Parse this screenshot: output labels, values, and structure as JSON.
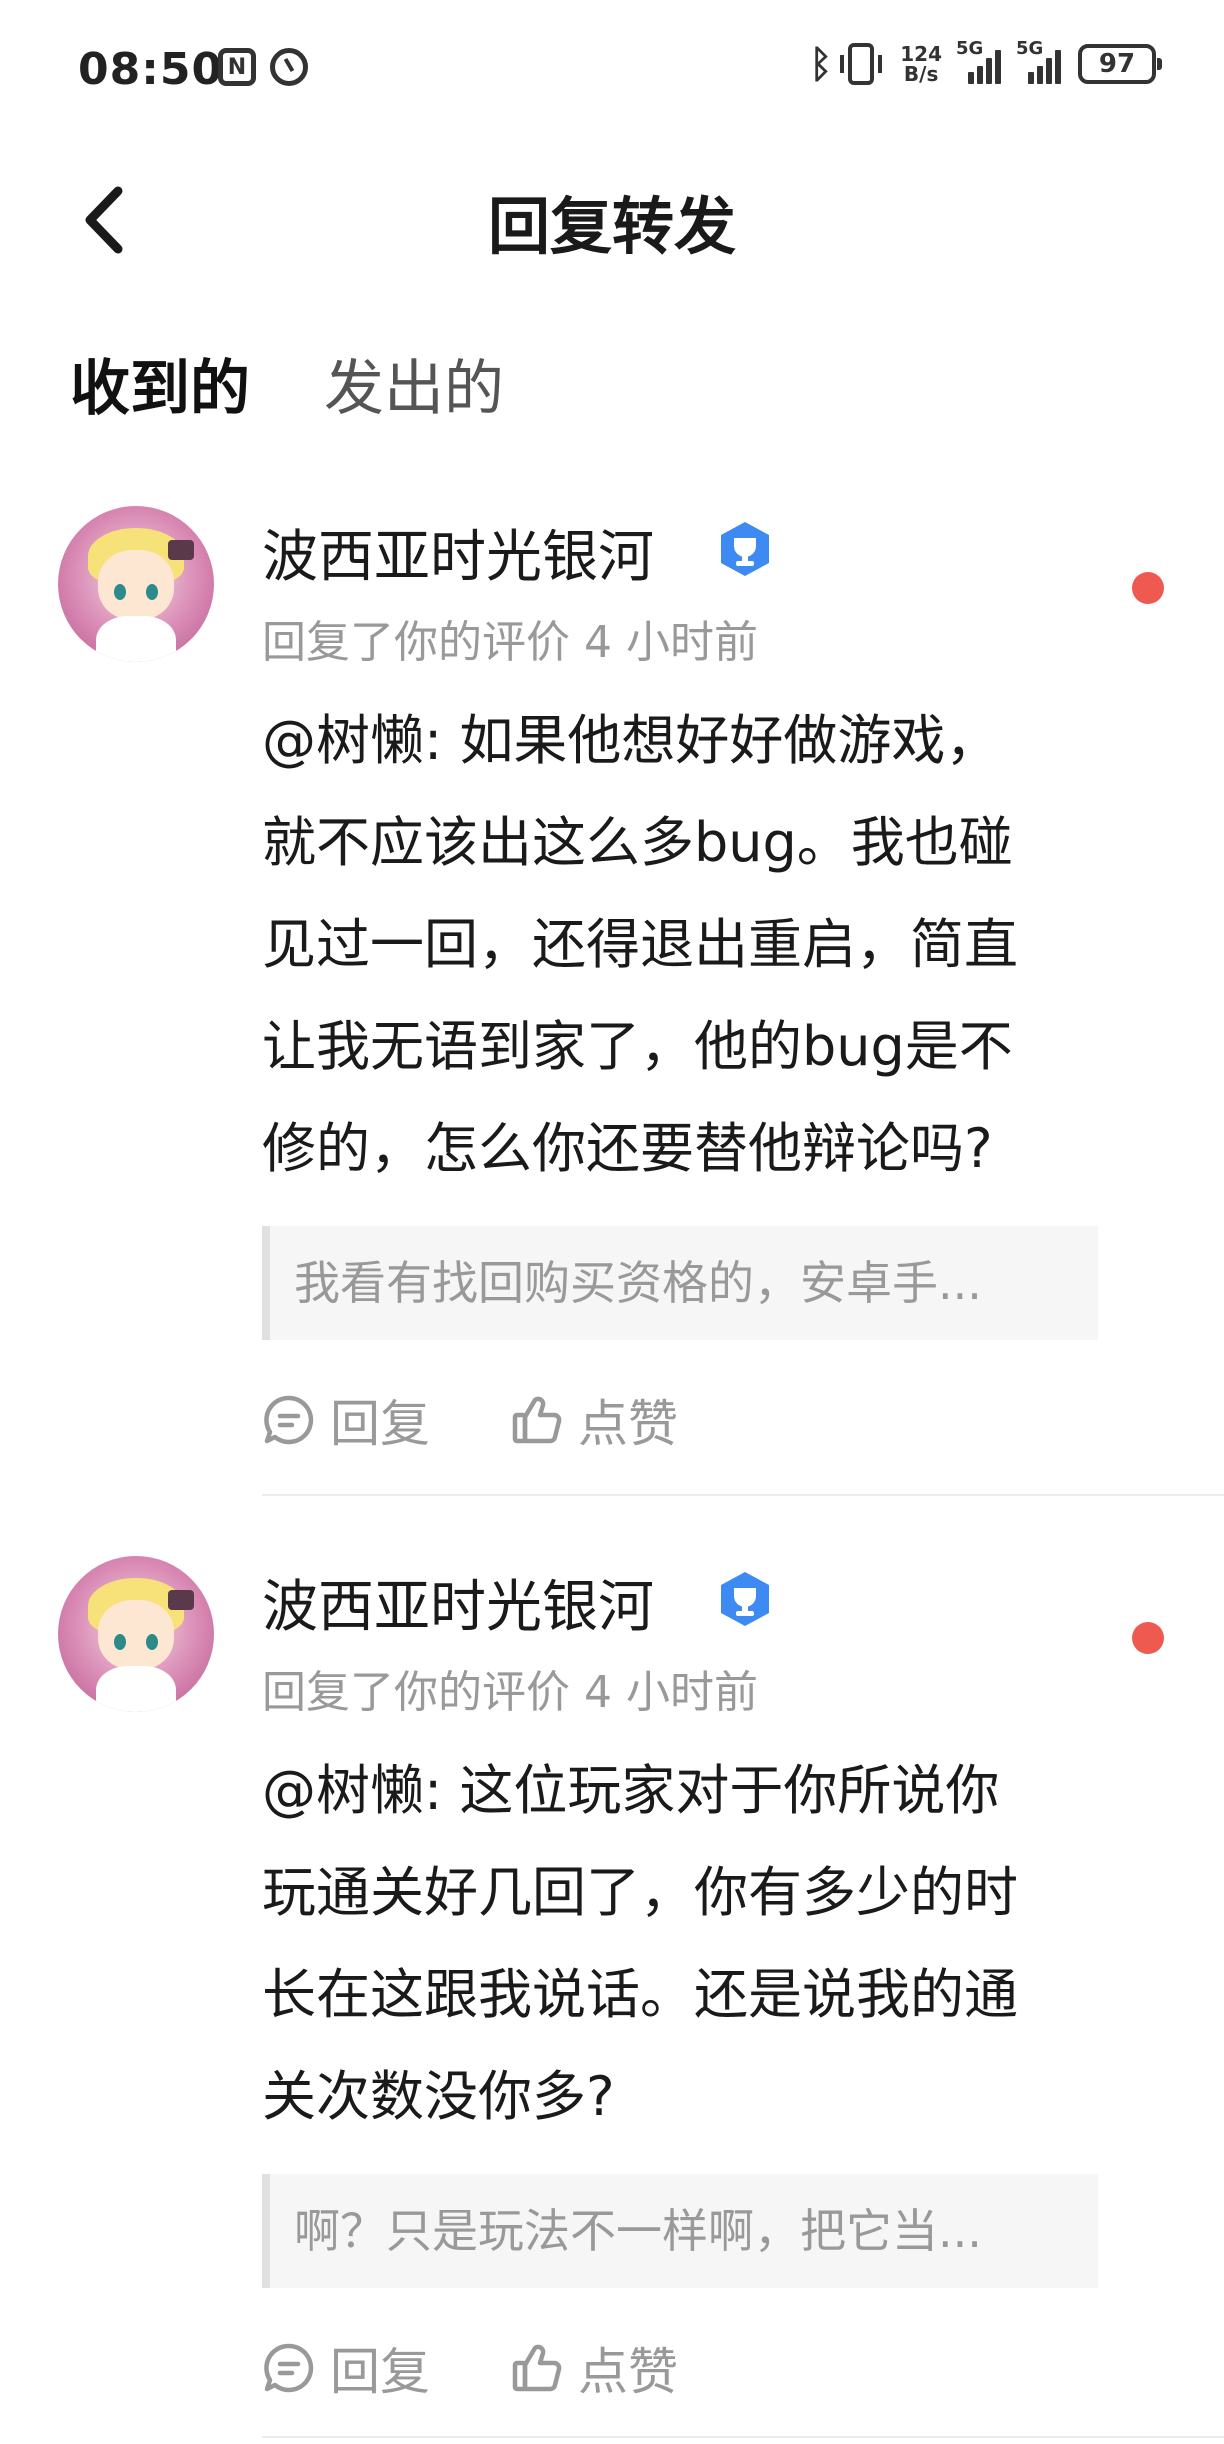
{
  "status_bar": {
    "time": "08:50",
    "nfc_label": "N",
    "speed_top": "124",
    "speed_bottom": "B/s",
    "sim1_label": "5G",
    "sim2_label": "5G",
    "battery": "97",
    "bluetooth_glyph": "ᛒ"
  },
  "header": {
    "title": "回复转发",
    "back_icon": "chevron-left-icon"
  },
  "tabs": [
    {
      "label": "收到的",
      "active": true
    },
    {
      "label": "发出的",
      "active": false
    }
  ],
  "replies": [
    {
      "username": "波西亚时光银河",
      "verified_icon": "verified-trophy-icon",
      "meta": "回复了你的评价 4 小时前",
      "unread": true,
      "content_lines": [
        "@树懒: 如果他想好好做游戏，",
        "就不应该出这么多bug。我也碰",
        "见过一回，还得退出重启，简直",
        "让我无语到家了，他的bug是不",
        "修的，怎么你还要替他辩论吗?"
      ],
      "quote": "我看有找回购买资格的，安卓手...",
      "reply_label": "回复",
      "like_label": "点赞"
    },
    {
      "username": "波西亚时光银河",
      "verified_icon": "verified-trophy-icon",
      "meta": "回复了你的评价 4 小时前",
      "unread": true,
      "content_lines": [
        "@树懒: 这位玩家对于你所说你",
        "玩通关好几回了，你有多少的时",
        "长在这跟我说话。还是说我的通",
        "关次数没你多?"
      ],
      "quote": "啊？只是玩法不一样啊，把它当...",
      "reply_label": "回复",
      "like_label": "点赞"
    }
  ],
  "colors": {
    "accent_underline": "#4fd1c5",
    "unread_dot": "#ee5a4f",
    "verified_blue": "#3d8bf2",
    "meta_gray": "#999999"
  }
}
